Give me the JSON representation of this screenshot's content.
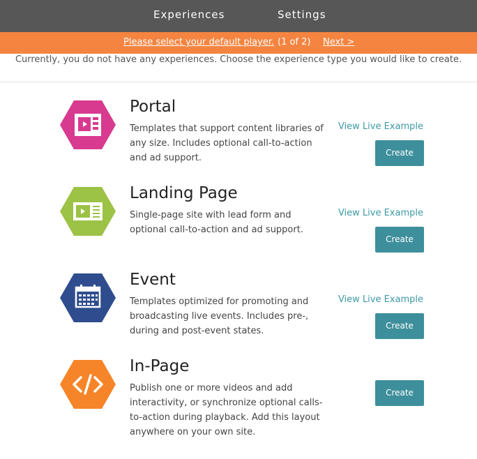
{
  "nav": {
    "experiences": "Experiences",
    "settings": "Settings"
  },
  "notice": {
    "link": "Please select your default player.",
    "progress": "(1 of 2)",
    "next": "Next >"
  },
  "intro": "Currently, you do not have any experiences. Choose the experience type you would like to create.",
  "types": [
    {
      "title": "Portal",
      "description": [
        "Templates that support content libraries of",
        "any size. Includes optional call-to-action",
        "and ad support."
      ],
      "example": "View Live Example",
      "create": "Create",
      "color": "#d83a8f",
      "icon": "portal-layout-icon"
    },
    {
      "title": "Landing Page",
      "description": [
        "Single-page site with lead form and",
        "optional call-to-action and ad support."
      ],
      "example": "View Live Example",
      "create": "Create",
      "color": "#9cc246",
      "icon": "landing-page-icon"
    },
    {
      "title": "Event",
      "description": [
        "Templates optimized for promoting and",
        "broadcasting live events. Includes pre-,",
        "during and post-event states."
      ],
      "example": "View Live Example",
      "create": "Create",
      "color": "#2f4d8e",
      "icon": "calendar-icon"
    },
    {
      "title": "In-Page",
      "description": [
        "Publish one or more videos and add",
        "interactivity, or synchronize optional calls-",
        "to-action during playback. Add this layout",
        "anywhere on your own site."
      ],
      "create": "Create",
      "color": "#f58528",
      "icon": "code-icon"
    }
  ]
}
